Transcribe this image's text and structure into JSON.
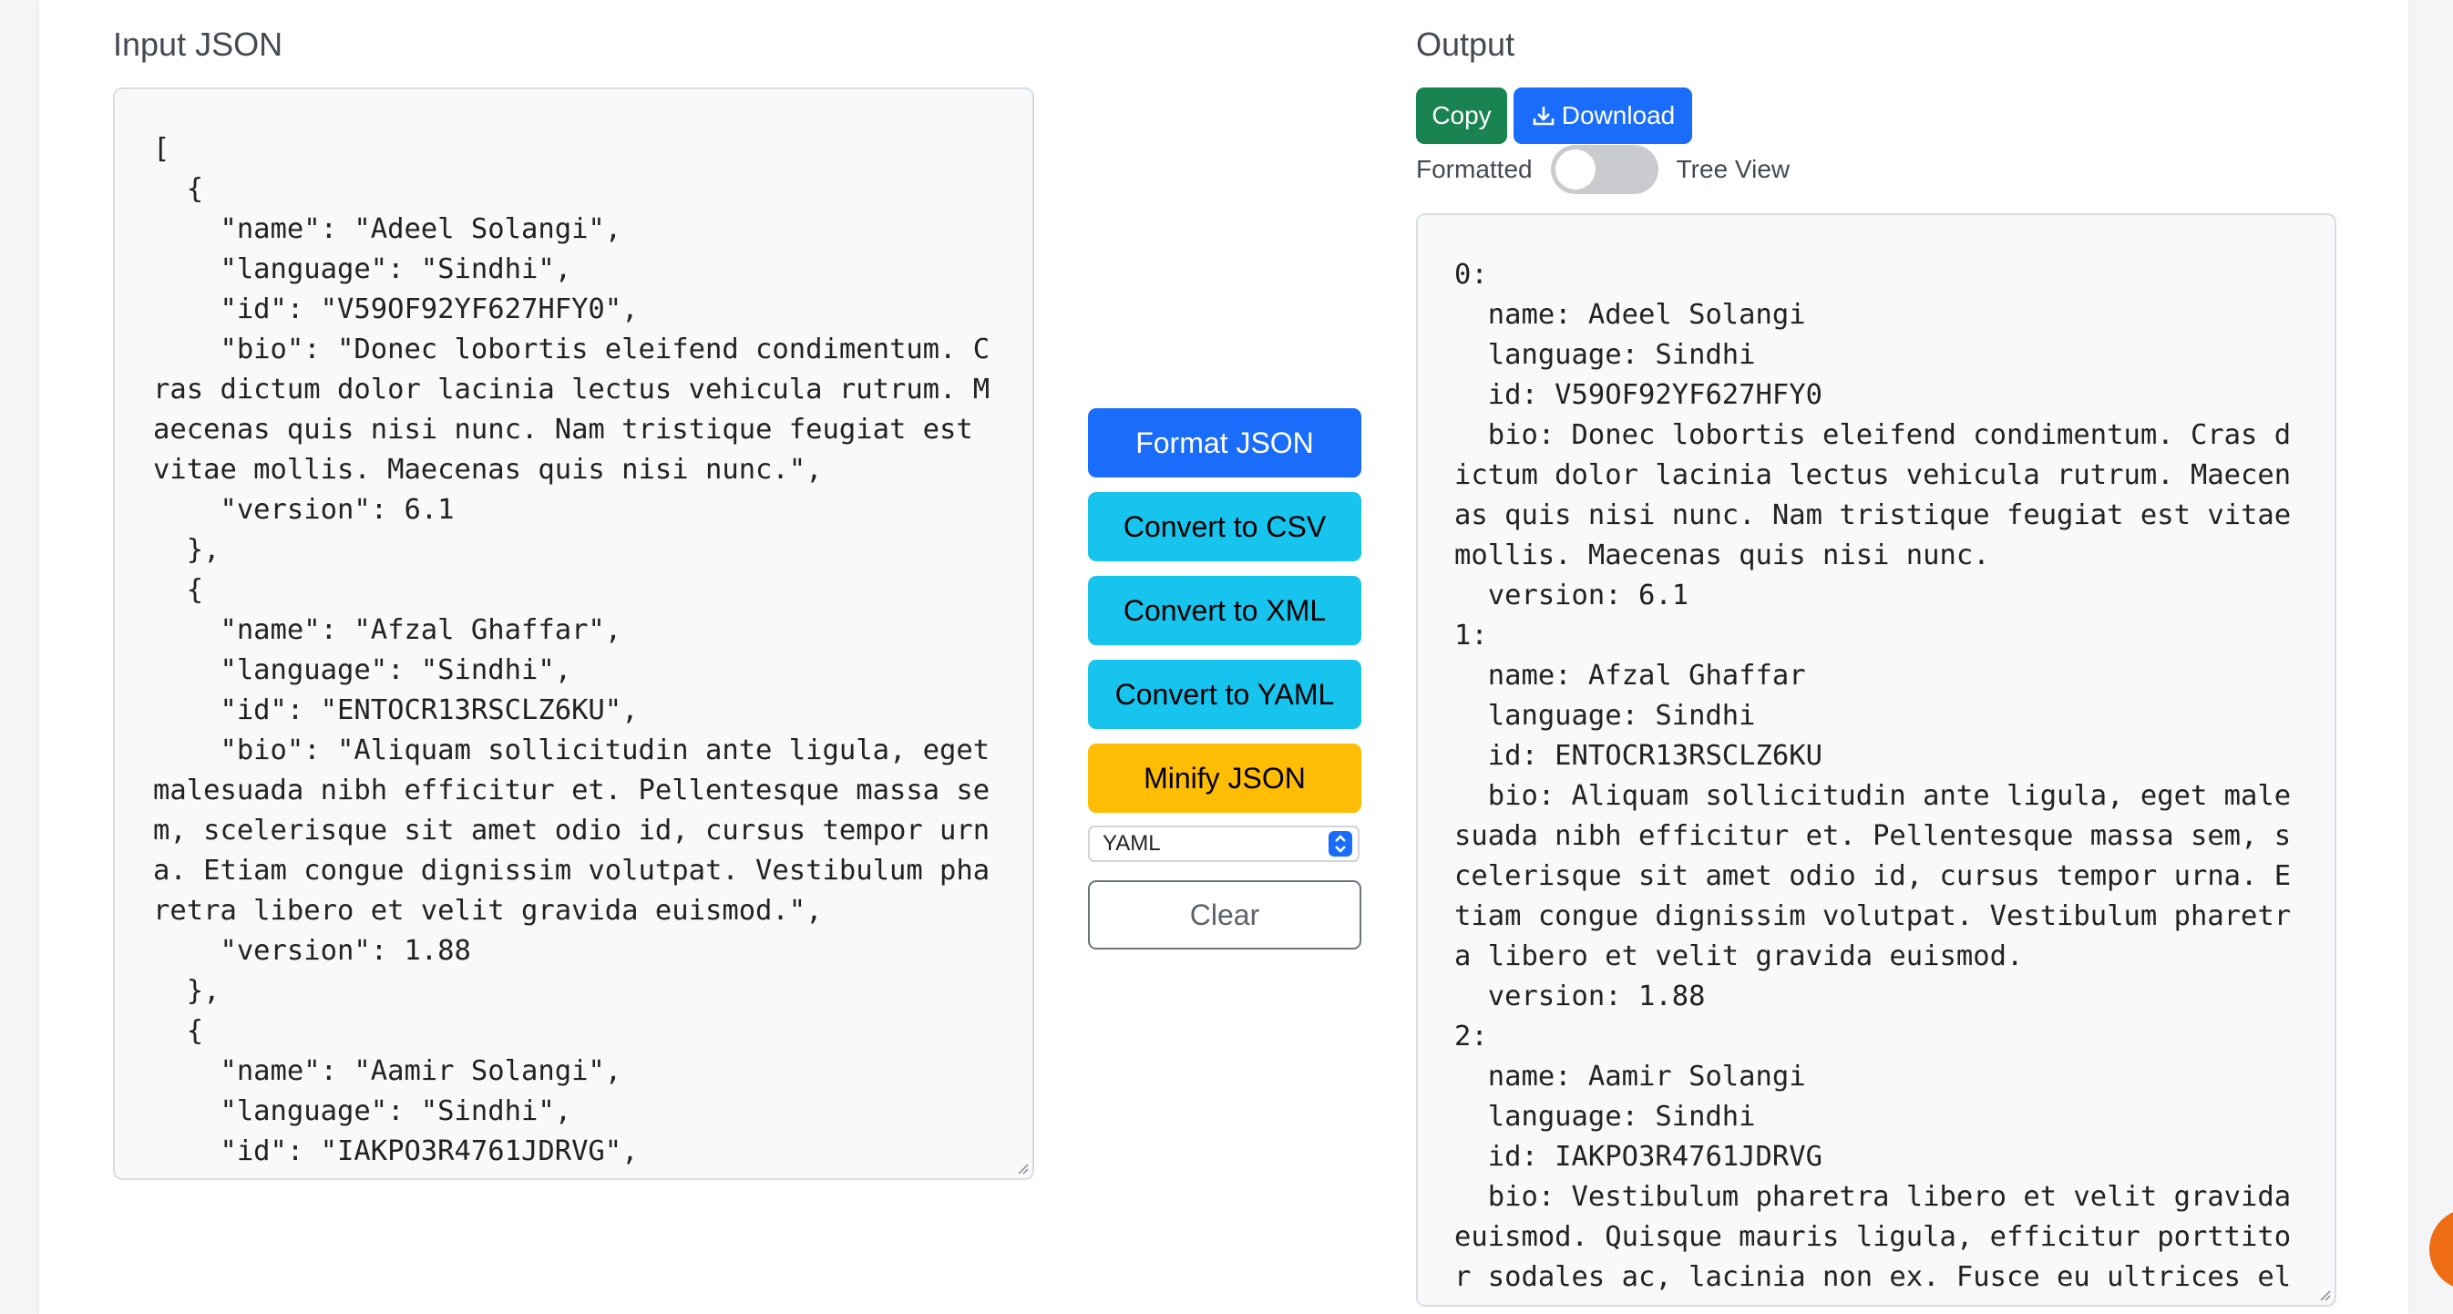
{
  "input": {
    "label": "Input JSON",
    "text": "[\n  {\n    \"name\": \"Adeel Solangi\",\n    \"language\": \"Sindhi\",\n    \"id\": \"V59OF92YF627HFY0\",\n    \"bio\": \"Donec lobortis eleifend condimentum. Cras dictum dolor lacinia lectus vehicula rutrum. Maecenas quis nisi nunc. Nam tristique feugiat est vitae mollis. Maecenas quis nisi nunc.\",\n    \"version\": 6.1\n  },\n  {\n    \"name\": \"Afzal Ghaffar\",\n    \"language\": \"Sindhi\",\n    \"id\": \"ENTOCR13RSCLZ6KU\",\n    \"bio\": \"Aliquam sollicitudin ante ligula, eget malesuada nibh efficitur et. Pellentesque massa sem, scelerisque sit amet odio id, cursus tempor urna. Etiam congue dignissim volutpat. Vestibulum pharetra libero et velit gravida euismod.\",\n    \"version\": 1.88\n  },\n  {\n    \"name\": \"Aamir Solangi\",\n    \"language\": \"Sindhi\",\n    \"id\": \"IAKPO3R4761JDRVG\",\n    \"bio\": \"Vestibulum pharetra libero et velit gravida euismod."
  },
  "actions": {
    "format": "Format JSON",
    "to_csv": "Convert to CSV",
    "to_xml": "Convert to XML",
    "to_yaml": "Convert to YAML",
    "minify": "Minify JSON",
    "format_select": "YAML",
    "clear": "Clear"
  },
  "output": {
    "label": "Output",
    "copy": "Copy",
    "download": "Download",
    "view_left": "Formatted",
    "view_right": "Tree View",
    "toggle_on": false,
    "text": "0:\n  name: Adeel Solangi\n  language: Sindhi\n  id: V59OF92YF627HFY0\n  bio: Donec lobortis eleifend condimentum. Cras dictum dolor lacinia lectus vehicula rutrum. Maecenas quis nisi nunc. Nam tristique feugiat est vitae mollis. Maecenas quis nisi nunc.\n  version: 6.1\n1:\n  name: Afzal Ghaffar\n  language: Sindhi\n  id: ENTOCR13RSCLZ6KU\n  bio: Aliquam sollicitudin ante ligula, eget malesuada nibh efficitur et. Pellentesque massa sem, scelerisque sit amet odio id, cursus tempor urna. Etiam congue dignissim volutpat. Vestibulum pharetra libero et velit gravida euismod.\n  version: 1.88\n2:\n  name: Aamir Solangi\n  language: Sindhi\n  id: IAKPO3R4761JDRVG\n  bio: Vestibulum pharetra libero et velit gravida euismod. Quisque mauris ligula, efficitur porttitor sodales ac, lacinia non ex. Fusce eu ultrices elit, vel posuere"
  },
  "colors": {
    "primary": "#1a6cfb",
    "info": "#17c4ee",
    "warning": "#ffbd06",
    "success": "#198451",
    "fab": "#ee6c14"
  },
  "icons": {
    "download": "download-icon",
    "select_arrows": "chevron-up-down-icon",
    "resize": "resize-handle-icon"
  }
}
